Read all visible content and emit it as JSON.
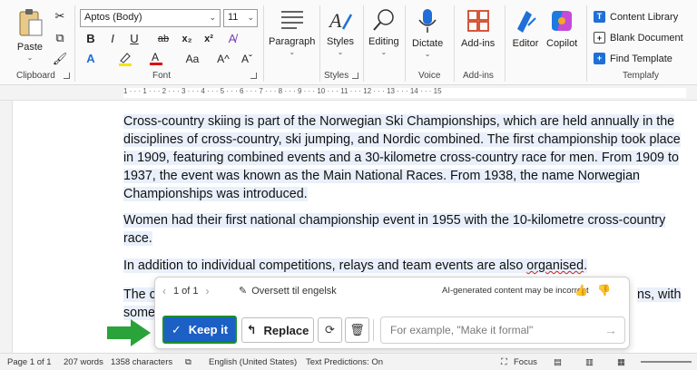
{
  "ribbon": {
    "clipboard": {
      "paste": "Paste",
      "group": "Clipboard"
    },
    "font": {
      "family": "Aptos (Body)",
      "size": "11",
      "group": "Font",
      "bold": "B",
      "italic": "I",
      "underline": "U",
      "strike": "ab",
      "subscript": "x₂",
      "superscript": "x²",
      "grow": "A^",
      "shrink": "Aˇ",
      "case": "Aa"
    },
    "paragraph": {
      "label": "Paragraph"
    },
    "styles": {
      "label": "Styles",
      "group": "Styles"
    },
    "editing": {
      "label": "Editing"
    },
    "voice": {
      "dictate": "Dictate",
      "group": "Voice"
    },
    "addins": {
      "label": "Add-ins",
      "group": "Add-ins"
    },
    "editor": {
      "label": "Editor"
    },
    "copilot": {
      "label": "Copilot"
    },
    "templafy": {
      "content_library": "Content Library",
      "blank_document": "Blank Document",
      "find_template": "Find Template",
      "group": "Templafy"
    }
  },
  "ruler": {
    "marks": "1 · · · 1 · · · 2 · · · 3 · · · 4 · · · 5 · · · 6 · · · 7 · · · 8 · · · 9 · · · 10 · · · 11 · · · 12 · · · 13 · · · 14 · · · 15"
  },
  "document": {
    "p1": "Cross-country skiing is part of the Norwegian Ski Championships, which are held annually in the disciplines of cross-country, ski jumping, and Nordic combined. The first championship took place in 1909, featuring combined events and a 30-kilometre cross-country race for men. From 1909 to 1937, the event was known as the Main National Races. From 1938, the name Norwegian Championships was introduced.",
    "p2": "Women had their first national championship event in 1955 with the 10-kilometre cross-country race.",
    "p3_pre": "In addition to individual competitions, relays and team events are also ",
    "p3_word": "organised",
    "p3_post": ".",
    "p4_left": "The c",
    "p4_right": "ns, with",
    "p5_left": "some"
  },
  "ai_popup": {
    "counter": "1 of 1",
    "action": "Oversett til engelsk",
    "disclaimer": "AI-generated content may be incorrect",
    "keep": "Keep it",
    "replace": "Replace",
    "placeholder": "For example, \"Make it formal\""
  },
  "status_bar": {
    "page": "Page 1 of 1",
    "words": "207 words",
    "chars": "1358 characters",
    "language": "English (United States)",
    "predictions": "Text Predictions: On",
    "focus": "Focus"
  },
  "colors": {
    "accent": "#1c5fc5",
    "highlight": "#e9f0fb",
    "arrow": "#2aa33a"
  }
}
